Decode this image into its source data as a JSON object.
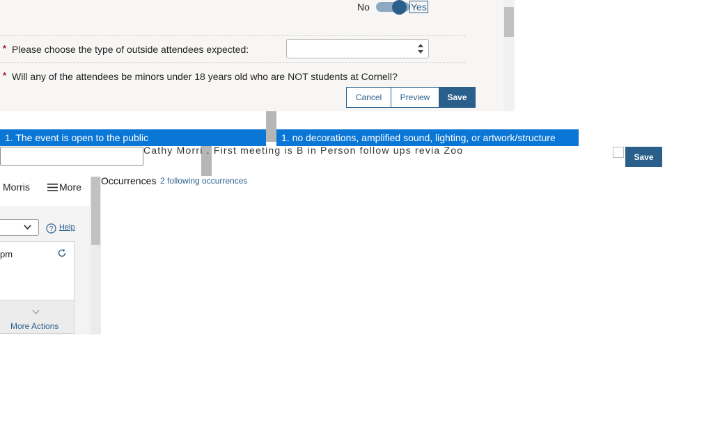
{
  "form": {
    "toggle_no": "No",
    "toggle_yes": "Yes",
    "required_mark": "*",
    "question_attendee_type": "Please choose the type of outside attendees expected:",
    "attendee_type_value": "",
    "question_minors": "Will any of the attendees be minors under 18 years old who are NOT students at Cornell?",
    "cancel_label": "Cancel",
    "preview_label": "Preview",
    "save_label": "Save"
  },
  "bars": {
    "bar1": "1. The event is open to the public",
    "bar2": "1. no decorations, amplified sound, lighting, or artwork/structure"
  },
  "note": {
    "input_value": "",
    "overlay_text": "Cathy Morri . First meeting is B in Person follow ups revia Zoo",
    "save_label": "Save"
  },
  "left": {
    "name": "Morris",
    "more": "More",
    "help": "Help",
    "time": "pm",
    "more_actions": "More Actions"
  },
  "occurrences": {
    "title": "Occurrences",
    "link": "2 following occurrences"
  },
  "colors": {
    "accent": "#2a5f8c",
    "bar_blue": "#0a76d6",
    "required": "#a0182b"
  },
  "icons": [
    "sort-arrows-icon",
    "menu-icon",
    "chevron-down-icon",
    "help-icon",
    "refresh-icon"
  ]
}
